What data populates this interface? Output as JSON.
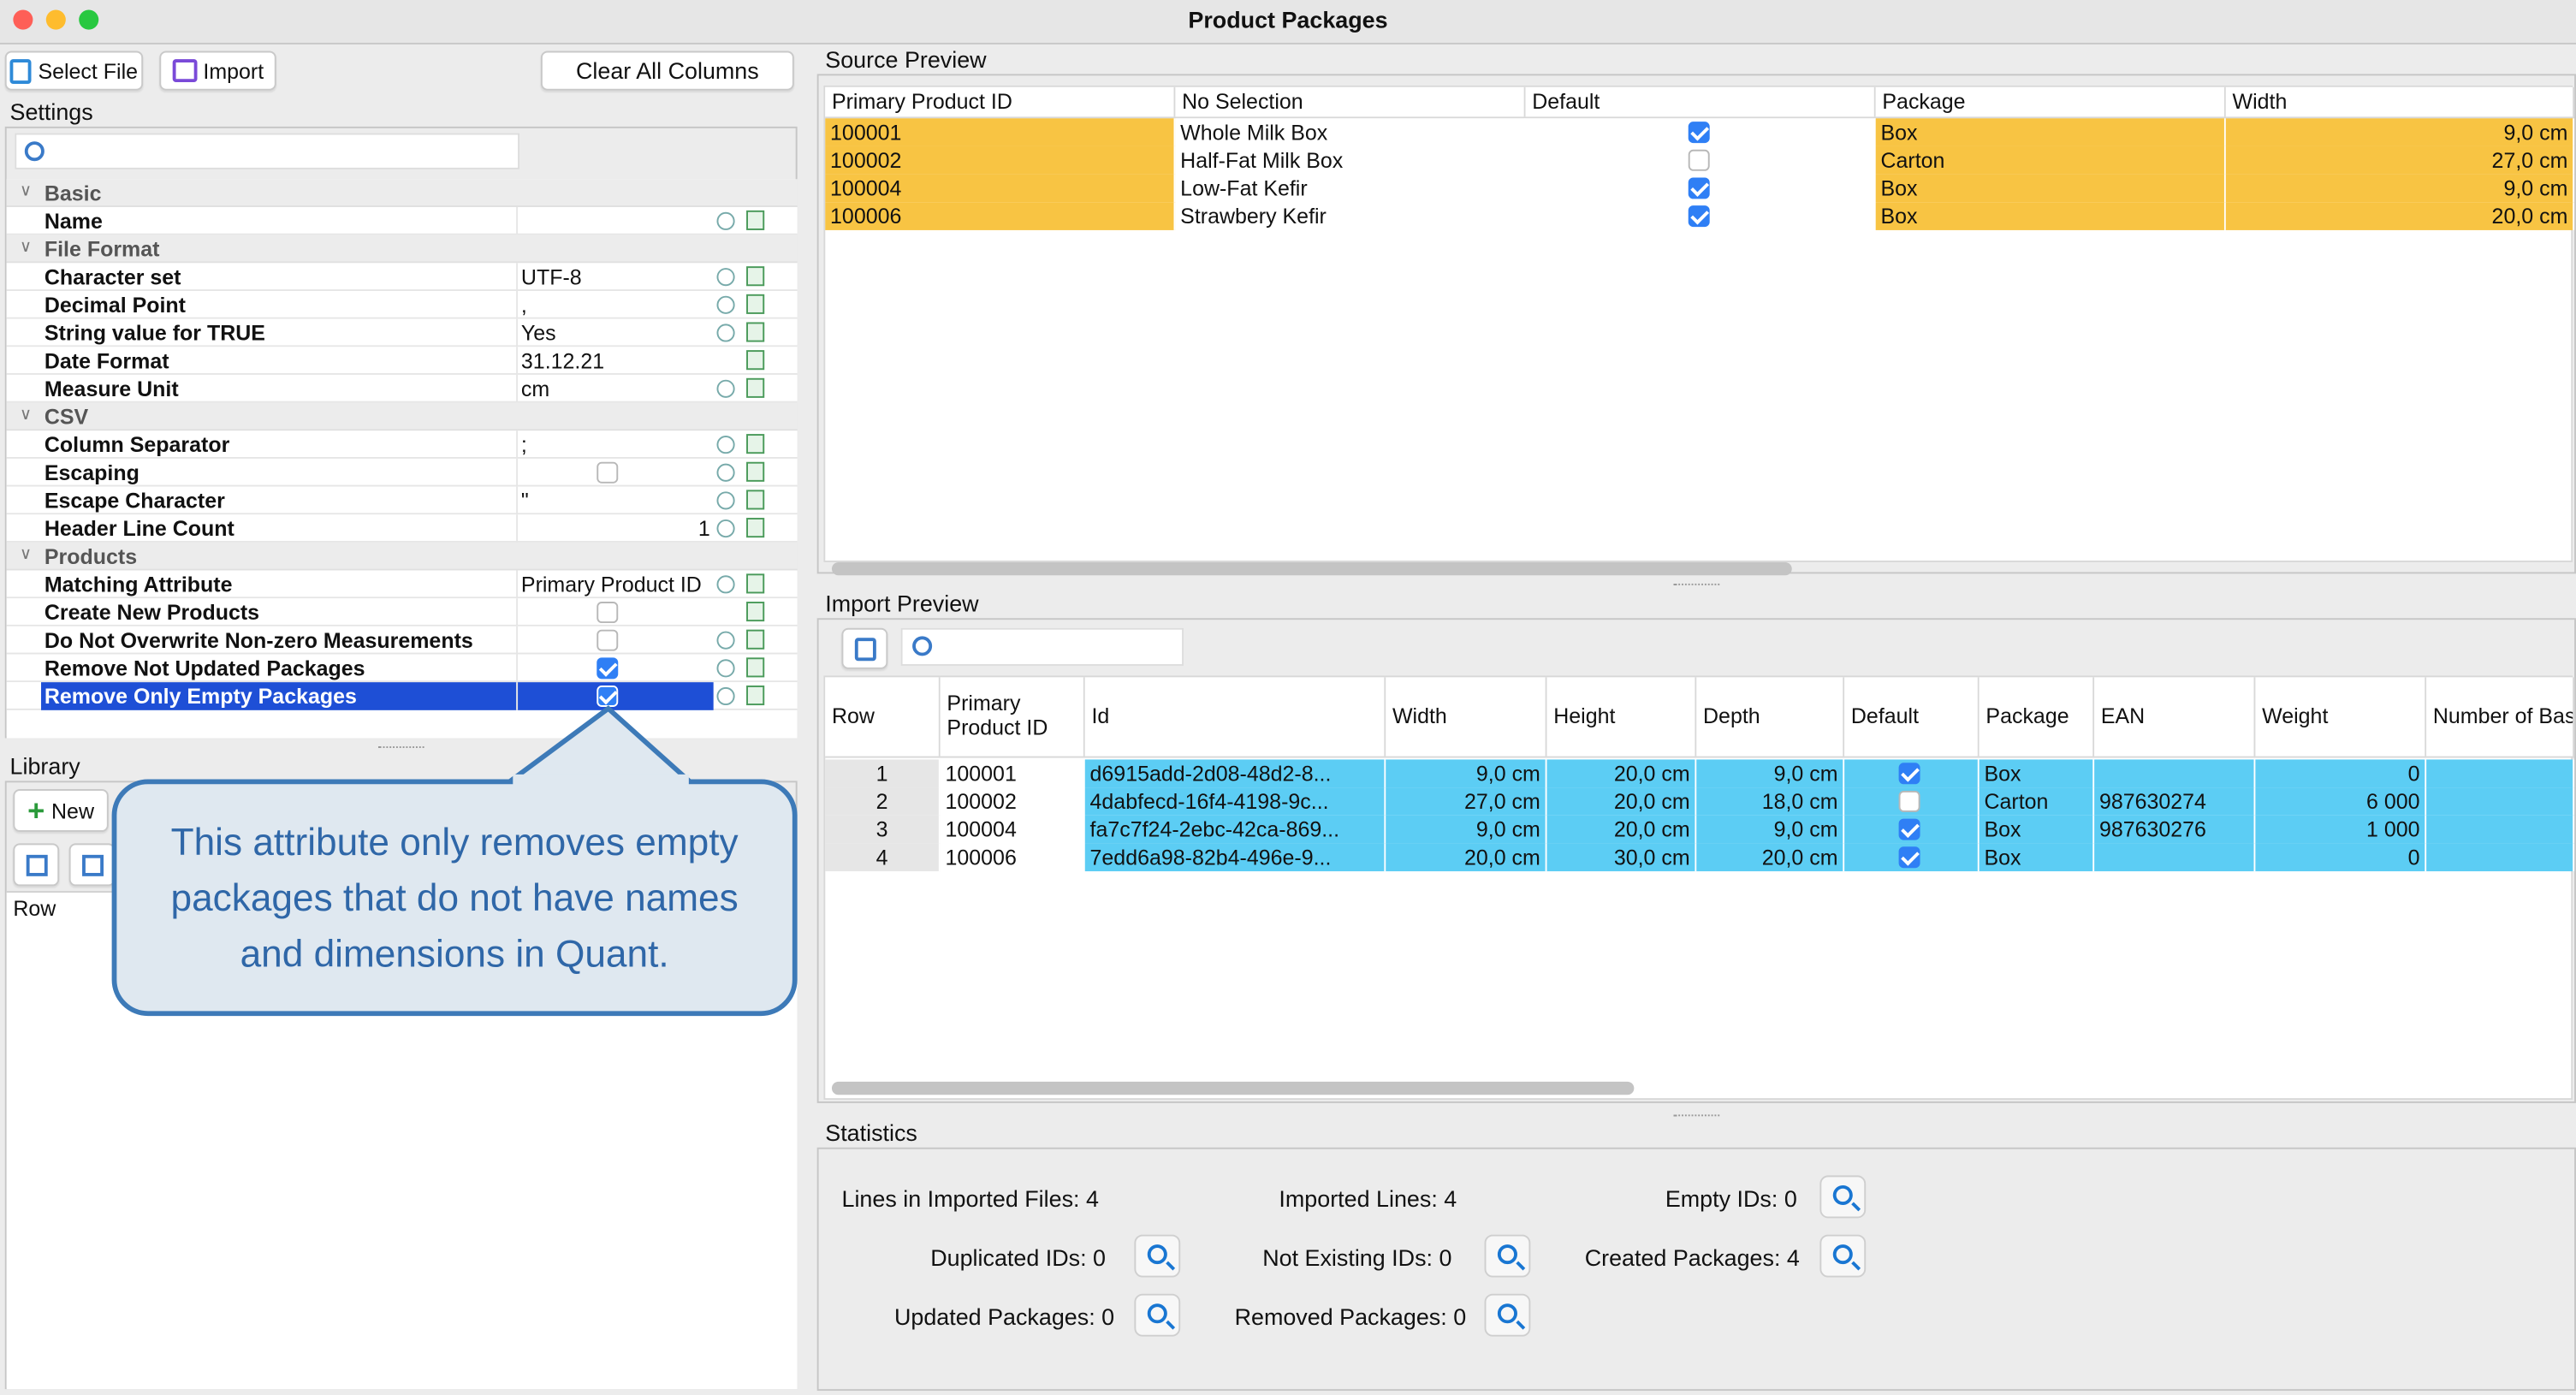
{
  "window": {
    "title": "Product Packages"
  },
  "toolbar": {
    "select_file": "Select File",
    "import": "Import",
    "clear_all_columns": "Clear All Columns"
  },
  "settings": {
    "label": "Settings",
    "search_placeholder": "",
    "categories": {
      "basic": "Basic",
      "file_format": "File Format",
      "csv": "CSV",
      "products": "Products"
    },
    "props": {
      "name": {
        "label": "Name",
        "value": ""
      },
      "charset": {
        "label": "Character set",
        "value": "UTF-8"
      },
      "decimal": {
        "label": "Decimal Point",
        "value": ","
      },
      "string_true": {
        "label": "String value for TRUE",
        "value": "Yes"
      },
      "date_format": {
        "label": "Date Format",
        "value": "31.12.21"
      },
      "measure_unit": {
        "label": "Measure Unit",
        "value": "cm"
      },
      "col_sep": {
        "label": "Column Separator",
        "value": ";"
      },
      "escaping": {
        "label": "Escaping",
        "checked": false
      },
      "escape_char": {
        "label": "Escape Character",
        "value": "\""
      },
      "header_count": {
        "label": "Header Line Count",
        "value": "1"
      },
      "matching_attr": {
        "label": "Matching Attribute",
        "value": "Primary Product ID"
      },
      "create_new": {
        "label": "Create New Products",
        "checked": false
      },
      "no_overwrite": {
        "label": "Do Not Overwrite Non-zero Measurements",
        "checked": false
      },
      "remove_not_updated": {
        "label": "Remove Not Updated Packages",
        "checked": true
      },
      "remove_only_empty": {
        "label": "Remove Only Empty Packages",
        "checked": true
      }
    }
  },
  "library": {
    "label": "Library",
    "new_button": "New",
    "column_row": "Row"
  },
  "callout": {
    "text": "This attribute only removes empty packages that do not have names and dimensions in Quant."
  },
  "source_preview": {
    "label": "Source Preview",
    "columns": [
      "Primary Product ID",
      "No Selection",
      "Default",
      "Package",
      "Width"
    ],
    "rows": [
      {
        "id": "100001",
        "name": "Whole Milk Box",
        "default": true,
        "package": "Box",
        "width": "9,0 cm"
      },
      {
        "id": "100002",
        "name": "Half-Fat Milk Box",
        "default": false,
        "package": "Carton",
        "width": "27,0 cm"
      },
      {
        "id": "100004",
        "name": "Low-Fat Kefir",
        "default": true,
        "package": "Box",
        "width": "9,0 cm"
      },
      {
        "id": "100006",
        "name": "Strawbery Kefir",
        "default": true,
        "package": "Box",
        "width": "20,0 cm"
      }
    ]
  },
  "import_preview": {
    "label": "Import Preview",
    "search_placeholder": "",
    "columns": {
      "row": "Row",
      "primary_id_1": "Primary",
      "primary_id_2": "Product ID",
      "id": "Id",
      "width": "Width",
      "height": "Height",
      "depth": "Depth",
      "default": "Default",
      "package": "Package",
      "ean": "EAN",
      "weight": "Weight",
      "number_of_bas": "Number of Bas"
    },
    "rows": [
      {
        "row": "1",
        "pid": "100001",
        "id": "d6915add-2d08-48d2-8...",
        "width": "9,0 cm",
        "height": "20,0 cm",
        "depth": "9,0 cm",
        "default": true,
        "package": "Box",
        "ean": "",
        "weight": "0"
      },
      {
        "row": "2",
        "pid": "100002",
        "id": "4dabfecd-16f4-4198-9c...",
        "width": "27,0 cm",
        "height": "20,0 cm",
        "depth": "18,0 cm",
        "default": false,
        "package": "Carton",
        "ean": "987630274",
        "weight": "6 000"
      },
      {
        "row": "3",
        "pid": "100004",
        "id": "fa7c7f24-2ebc-42ca-869...",
        "width": "9,0 cm",
        "height": "20,0 cm",
        "depth": "9,0 cm",
        "default": true,
        "package": "Box",
        "ean": "987630276",
        "weight": "1 000"
      },
      {
        "row": "4",
        "pid": "100006",
        "id": "7edd6a98-82b4-496e-9...",
        "width": "20,0 cm",
        "height": "30,0 cm",
        "depth": "20,0 cm",
        "default": true,
        "package": "Box",
        "ean": "",
        "weight": "0"
      }
    ]
  },
  "statistics": {
    "label": "Statistics",
    "lines_in_imported_files": {
      "label": "Lines in Imported Files:",
      "value": "4"
    },
    "imported_lines": {
      "label": "Imported Lines:",
      "value": "4"
    },
    "empty_ids": {
      "label": "Empty IDs:",
      "value": "0"
    },
    "duplicated_ids": {
      "label": "Duplicated IDs:",
      "value": "0"
    },
    "not_existing_ids": {
      "label": "Not Existing IDs:",
      "value": "0"
    },
    "created_packages": {
      "label": "Created Packages:",
      "value": "4"
    },
    "updated_packages": {
      "label": "Updated Packages:",
      "value": "0"
    },
    "removed_packages": {
      "label": "Removed Packages:",
      "value": "0"
    }
  },
  "colors": {
    "source_highlight": "#f8c443",
    "import_highlight": "#5ccdf4",
    "selection": "#1e4fd6"
  }
}
